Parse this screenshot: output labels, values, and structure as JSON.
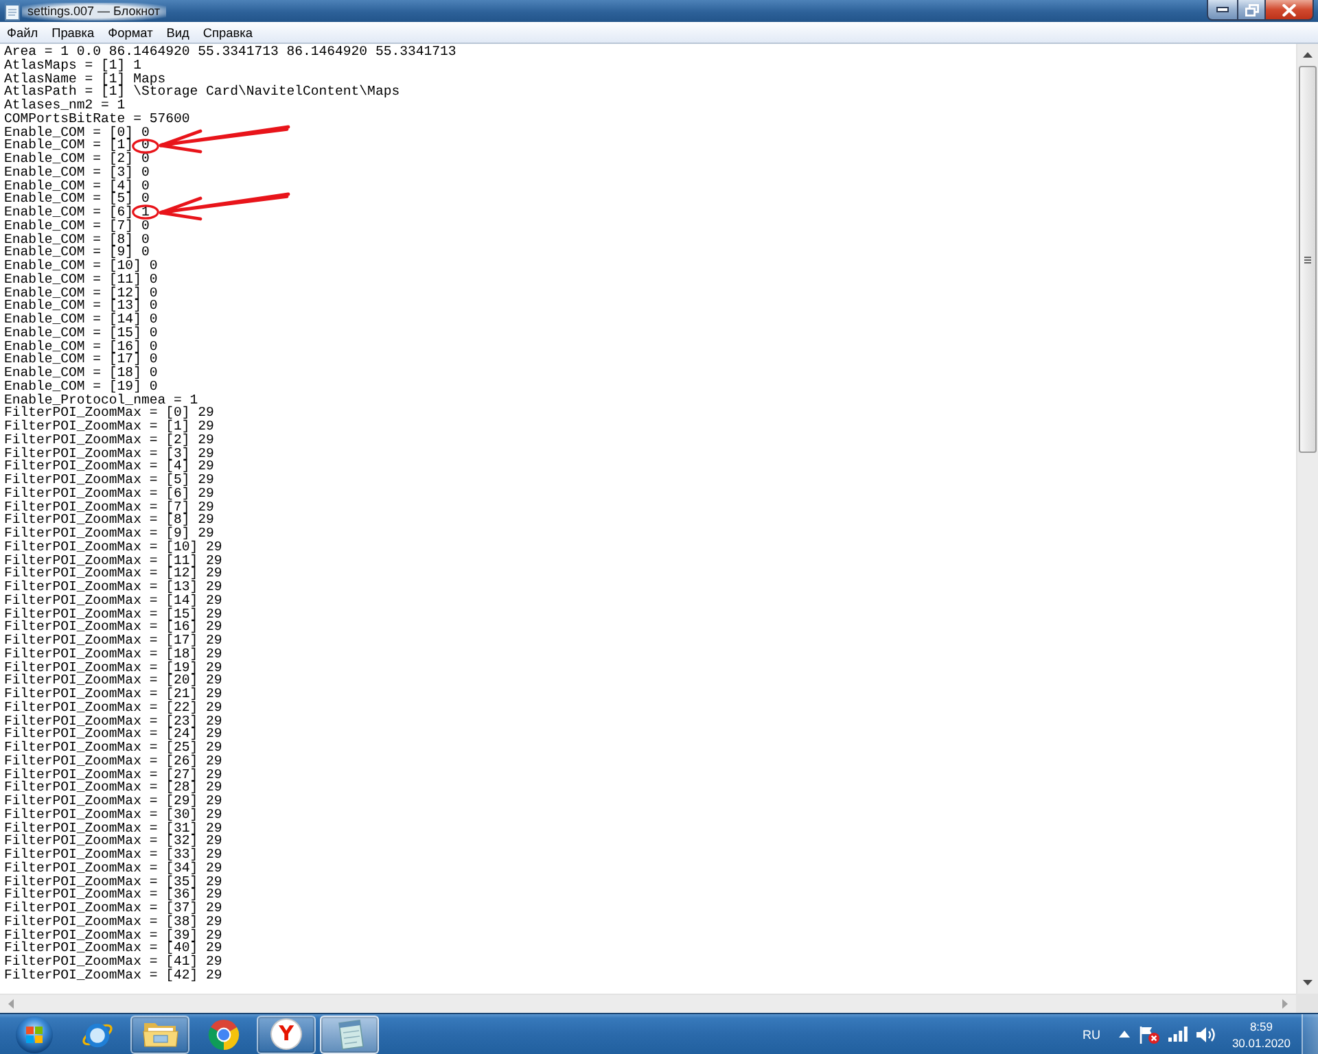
{
  "window": {
    "title": "settings.007 — Блокнот"
  },
  "menu": [
    "Файл",
    "Правка",
    "Формат",
    "Вид",
    "Справка"
  ],
  "editor": {
    "lines": [
      {
        "text": "Area = 1 0.0 86.1464920 55.3341713 86.1464920 55.3341713",
        "marked": false
      },
      {
        "text": "AtlasMaps = [1] 1",
        "marked": false
      },
      {
        "text": "AtlasName = [1] Maps",
        "marked": false
      },
      {
        "text": "AtlasPath = [1] \\Storage Card\\NavitelContent\\Maps",
        "marked": false
      },
      {
        "text": "Atlases_nm2 = 1",
        "marked": false
      },
      {
        "text": "COMPortsBitRate = 57600",
        "marked": false
      },
      {
        "text": "Enable_COM = [0] 0",
        "marked": false
      },
      {
        "text": "Enable_COM = [1] 0",
        "marked": true
      },
      {
        "text": "Enable_COM = [2] 0",
        "marked": false
      },
      {
        "text": "Enable_COM = [3] 0",
        "marked": false
      },
      {
        "text": "Enable_COM = [4] 0",
        "marked": false
      },
      {
        "text": "Enable_COM = [5] 0",
        "marked": false
      },
      {
        "text": "Enable_COM = [6] 1",
        "marked": true
      },
      {
        "text": "Enable_COM = [7] 0",
        "marked": false
      },
      {
        "text": "Enable_COM = [8] 0",
        "marked": false
      },
      {
        "text": "Enable_COM = [9] 0",
        "marked": false
      },
      {
        "text": "Enable_COM = [10] 0",
        "marked": false
      },
      {
        "text": "Enable_COM = [11] 0",
        "marked": false
      },
      {
        "text": "Enable_COM = [12] 0",
        "marked": false
      },
      {
        "text": "Enable_COM = [13] 0",
        "marked": false
      },
      {
        "text": "Enable_COM = [14] 0",
        "marked": false
      },
      {
        "text": "Enable_COM = [15] 0",
        "marked": false
      },
      {
        "text": "Enable_COM = [16] 0",
        "marked": false
      },
      {
        "text": "Enable_COM = [17] 0",
        "marked": false
      },
      {
        "text": "Enable_COM = [18] 0",
        "marked": false
      },
      {
        "text": "Enable_COM = [19] 0",
        "marked": false
      },
      {
        "text": "Enable_Protocol_nmea = 1",
        "marked": false
      },
      {
        "text": "FilterPOI_ZoomMax = [0] 29",
        "marked": false
      },
      {
        "text": "FilterPOI_ZoomMax = [1] 29",
        "marked": false
      },
      {
        "text": "FilterPOI_ZoomMax = [2] 29",
        "marked": false
      },
      {
        "text": "FilterPOI_ZoomMax = [3] 29",
        "marked": false
      },
      {
        "text": "FilterPOI_ZoomMax = [4] 29",
        "marked": false
      },
      {
        "text": "FilterPOI_ZoomMax = [5] 29",
        "marked": false
      },
      {
        "text": "FilterPOI_ZoomMax = [6] 29",
        "marked": false
      },
      {
        "text": "FilterPOI_ZoomMax = [7] 29",
        "marked": false
      },
      {
        "text": "FilterPOI_ZoomMax = [8] 29",
        "marked": false
      },
      {
        "text": "FilterPOI_ZoomMax = [9] 29",
        "marked": false
      },
      {
        "text": "FilterPOI_ZoomMax = [10] 29",
        "marked": false
      },
      {
        "text": "FilterPOI_ZoomMax = [11] 29",
        "marked": false
      },
      {
        "text": "FilterPOI_ZoomMax = [12] 29",
        "marked": false
      },
      {
        "text": "FilterPOI_ZoomMax = [13] 29",
        "marked": false
      },
      {
        "text": "FilterPOI_ZoomMax = [14] 29",
        "marked": false
      },
      {
        "text": "FilterPOI_ZoomMax = [15] 29",
        "marked": false
      },
      {
        "text": "FilterPOI_ZoomMax = [16] 29",
        "marked": false
      },
      {
        "text": "FilterPOI_ZoomMax = [17] 29",
        "marked": false
      },
      {
        "text": "FilterPOI_ZoomMax = [18] 29",
        "marked": false
      },
      {
        "text": "FilterPOI_ZoomMax = [19] 29",
        "marked": false
      },
      {
        "text": "FilterPOI_ZoomMax = [20] 29",
        "marked": false
      },
      {
        "text": "FilterPOI_ZoomMax = [21] 29",
        "marked": false
      },
      {
        "text": "FilterPOI_ZoomMax = [22] 29",
        "marked": false
      },
      {
        "text": "FilterPOI_ZoomMax = [23] 29",
        "marked": false
      },
      {
        "text": "FilterPOI_ZoomMax = [24] 29",
        "marked": false
      },
      {
        "text": "FilterPOI_ZoomMax = [25] 29",
        "marked": false
      },
      {
        "text": "FilterPOI_ZoomMax = [26] 29",
        "marked": false
      },
      {
        "text": "FilterPOI_ZoomMax = [27] 29",
        "marked": false
      },
      {
        "text": "FilterPOI_ZoomMax = [28] 29",
        "marked": false
      },
      {
        "text": "FilterPOI_ZoomMax = [29] 29",
        "marked": false
      },
      {
        "text": "FilterPOI_ZoomMax = [30] 29",
        "marked": false
      },
      {
        "text": "FilterPOI_ZoomMax = [31] 29",
        "marked": false
      },
      {
        "text": "FilterPOI_ZoomMax = [32] 29",
        "marked": false
      },
      {
        "text": "FilterPOI_ZoomMax = [33] 29",
        "marked": false
      },
      {
        "text": "FilterPOI_ZoomMax = [34] 29",
        "marked": false
      },
      {
        "text": "FilterPOI_ZoomMax = [35] 29",
        "marked": false
      },
      {
        "text": "FilterPOI_ZoomMax = [36] 29",
        "marked": false
      },
      {
        "text": "FilterPOI_ZoomMax = [37] 29",
        "marked": false
      },
      {
        "text": "FilterPOI_ZoomMax = [38] 29",
        "marked": false
      },
      {
        "text": "FilterPOI_ZoomMax = [39] 29",
        "marked": false
      },
      {
        "text": "FilterPOI_ZoomMax = [40] 29",
        "marked": false
      },
      {
        "text": "FilterPOI_ZoomMax = [41] 29",
        "marked": false
      },
      {
        "text": "FilterPOI_ZoomMax = [42] 29",
        "marked": false
      }
    ]
  },
  "taskbar": {
    "items": [
      {
        "kind": "globe",
        "running": false,
        "selected": false
      },
      {
        "kind": "folder",
        "running": true,
        "selected": false
      },
      {
        "kind": "wheel",
        "running": false,
        "selected": false
      },
      {
        "kind": "letter",
        "running": true,
        "selected": false,
        "glyph": "Y"
      },
      {
        "kind": "notepad",
        "running": true,
        "selected": true
      }
    ],
    "tray": {
      "language": "RU",
      "time": "8:59",
      "date": "30.01.2020"
    }
  }
}
